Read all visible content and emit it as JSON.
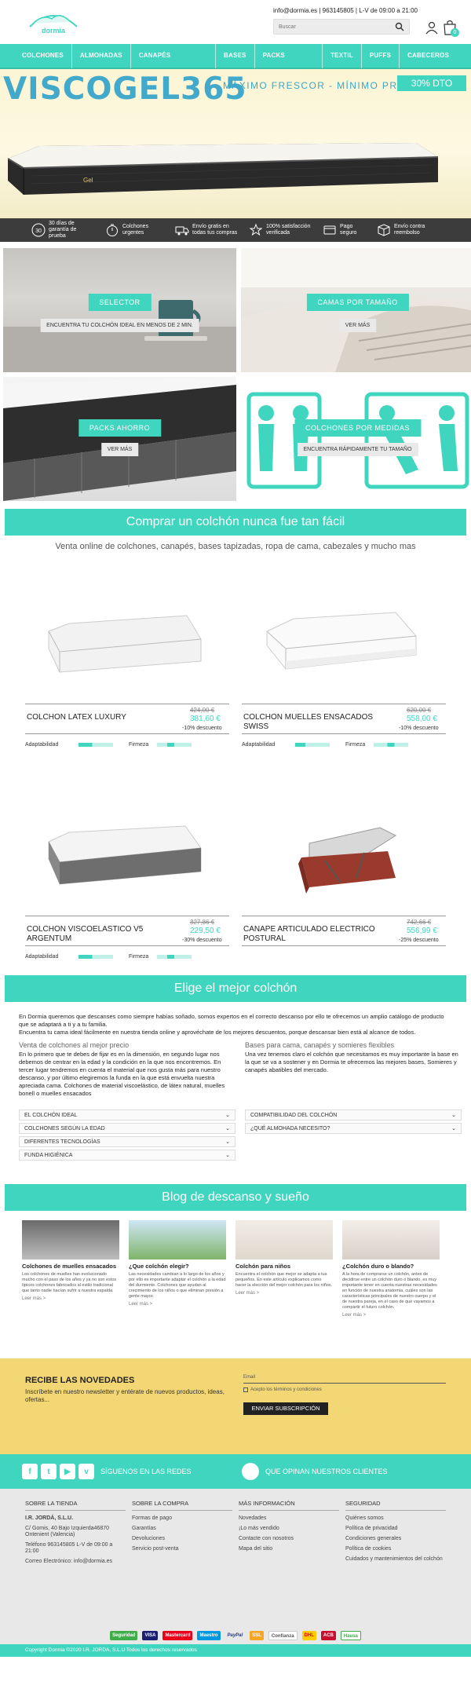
{
  "header": {
    "logo_text": "dormia",
    "contact": "info@dormia.es | 963145805 | L-V de 09:00 a 21:00",
    "search_placeholder": "Buscar",
    "cart_count": "0"
  },
  "nav": [
    "COLCHONES",
    "ALMOHADAS",
    "CANAPÉS ABATIBLES",
    "BASES",
    "PACKS AHORRO",
    "TEXTIL",
    "PUFFS",
    "CABECEROS"
  ],
  "hero": {
    "title": "VISCOGEL365",
    "slogan": "MÁXIMO FRESCOR - MÍNIMO PRECIO",
    "badge": "30% DTO"
  },
  "trust": [
    {
      "icon": "30-days-icon",
      "text": "30 días de garantía de prueba"
    },
    {
      "icon": "stopwatch-icon",
      "text": "Colchones urgentes"
    },
    {
      "icon": "truck-icon",
      "text": "Envío gratis en todas tus compras"
    },
    {
      "icon": "rating-icon",
      "text": "100% satisfacción verificada"
    },
    {
      "icon": "payment-icon",
      "text": "Pago seguro"
    },
    {
      "icon": "box-icon",
      "text": "Envío contra reembolso"
    }
  ],
  "categories": [
    {
      "label": "SELECTOR",
      "sub": "ENCUENTRA TU COLCHÓN IDEAL EN MENOS DE 2 MIN."
    },
    {
      "label": "CAMAS POR TAMAÑO",
      "sub": "VER MÁS"
    },
    {
      "label": "PACKS AHORRO",
      "sub": "VER MÁS"
    },
    {
      "label": "COLCHONES POR MEDIDAS",
      "sub": "ENCUENTRA RÁPIDAMENTE TU TAMAÑO"
    }
  ],
  "section1": {
    "title": "Comprar un colchón nunca fue tan fácil",
    "subtitle": "Venta online de colchones, canapés, bases tapizadas, ropa de cama, cabezales y mucho mas"
  },
  "products": [
    {
      "name": "COLCHON LATEX LUXURY",
      "old_price": "424,00 €",
      "price": "381,60 €",
      "discount": "-10% descuento",
      "rating1": "Adaptabilidad",
      "rating2": "Firmeza",
      "adapt_level": 0.4,
      "firm_level": 0.5
    },
    {
      "name": "COLCHON MUELLES ENSACADOS SWISS",
      "old_price": "620,00 €",
      "price": "558,00 €",
      "discount": "-10% descuento",
      "rating1": "Adaptabilidad",
      "rating2": "Firmeza",
      "adapt_level": 0.3,
      "firm_level": 0.6
    },
    {
      "name": "COLCHON VISCOELASTICO V5 ARGENTUM",
      "old_price": "327,86 €",
      "price": "229,50 €",
      "discount": "-30% descuento",
      "rating1": "Adaptabilidad",
      "rating2": "Firmeza",
      "adapt_level": 0.4,
      "firm_level": 0.5
    },
    {
      "name": "CANAPE ARTICULADO ELECTRICO POSTURAL",
      "old_price": "742,66 €",
      "price": "556,99 €",
      "discount": "-25% descuento",
      "rating1": "",
      "rating2": "",
      "adapt_level": 0,
      "firm_level": 0
    }
  ],
  "section2": {
    "title": "Elige el mejor colchón",
    "intro": "En Dormia queremos que descanses como siempre habías soñado, somos expertos en el correcto descanso por ello te ofrecemos un amplio catálogo de producto que se adaptará a ti y a tu familia.",
    "intro2": "Encuentra tu cama ideal fácilmente en nuestra tienda online y aprovéchate de los mejores descuentos, porque descansar bien está al alcance de todos.",
    "left_h": "Venta de colchones al mejor precio",
    "left_t": "En lo primero que te debes de fijar es en la dimensión, en segundo lugar nos debemos de centrar en la edad y la condición en la que nos encontremos. En tercer lugar tendremos en cuenta el material que nos gusta más para nuestro descanso, y por último elegiremos la funda en la que está envuelta nuestra apreciada cama. Colchones de material viscoelástico, de látex natural, muelles bonell o muelles ensacados",
    "right_h": "Bases para cama, canapés y somieres flexibles",
    "right_t": "Una vez tenemos claro el colchón que necesitamos es muy importante la base en la que se va a sostener y en Dormia te ofrecemos las mejores bases, Somieres y canapés abatibles del mercado.",
    "acc_left": [
      "EL COLCHÓN IDEAL",
      "COLCHONES SEGÚN LA EDAD",
      "DIFERENTES TECNOLOGÍAS",
      "FUNDA HIGIÉNICA"
    ],
    "acc_right": [
      "COMPATIBILIDAD DEL COLCHÓN",
      "¿QUÉ ALMOHADA NECESITO?"
    ]
  },
  "section3": {
    "title": "Blog de descanso y sueño"
  },
  "blog": [
    {
      "title": "Colchones de muelles ensacados",
      "text": "Los colchones de muelles han evolucionado mucho con el paso de los años y ya no son estos típicos colchones fabricados al estilo tradicional que tanto nadie hacían sufrir a nuestra espalda.",
      "more": "Leer más >"
    },
    {
      "title": "¿Que colchón elegir?",
      "text": "Las necesidades cambian a lo largo de los años y por ello es importante adaptar el colchón a la edad del durmiente. Colchones que ayudan al crecimiento de los niños o que eliminan presión a gente mayor.",
      "more": "Leer más >"
    },
    {
      "title": "Colchón para niños",
      "text": "Encuentra el colchón que mejor se adapta a tus pequeños. En este artículo explicamos como hacer la elección del mejor colchón para los niños.",
      "more": "Leer más >"
    },
    {
      "title": "¿Colchón duro o blando?",
      "text": "A la hora de comprarse un colchón, antes de decidirse entre un colchón duro o blando, es muy importante tener en cuenta nuestras necesidades en función de nuestra anatomía, cuáles son las características principales de nuestro cuerpo y el de nuestra pareja, en el caso de que vayamos a compartir el futuro colchón.",
      "more": "Leer más >"
    }
  ],
  "newsletter": {
    "title": "RECIBE LAS NOVEDADES",
    "text": "Inscríbete en nuestro newsletter y entérate de nuevos productos, ideas, ofertas...",
    "email_label": "Email",
    "accept": "Acepto los términos y condiciones",
    "button": "ENVIAR SUBSCRIPCIÓN"
  },
  "social": {
    "follow": "SÍGUENOS EN LAS REDES",
    "reviews": "QUE OPINAN NUESTROS CLIENTES"
  },
  "footer": {
    "col1_h": "SOBRE LA TIENDA",
    "col1": [
      "I.R. JORDÁ, S.L.U.",
      "C/ Gomis, 40 Bajo Izquierda46870 Ontenient (Valencia)",
      "Teléfono 963145805 L-V de 09:00 a 21:00",
      "Correo Electrónico: info@dormia.es"
    ],
    "col2_h": "SOBRE LA COMPRA",
    "col2": [
      "Formas de pago",
      "Garantías",
      "Devoluciones",
      "Servicio post-venta"
    ],
    "col3_h": "MÁS INFORMACIÓN",
    "col3": [
      "Novedades",
      "¡Lo más vendido",
      "Contacte con nosotros",
      "Mapa del sitio"
    ],
    "col4_h": "SEGURIDAD",
    "col4": [
      "Quiénes somos",
      "Política de privacidad",
      "Condiciones generales",
      "Política de cookies",
      "Cuidados y mantenimientos del colchón"
    ]
  },
  "payments": [
    "Seguridad",
    "VISA",
    "Mastercard",
    "Maestro",
    "PayPal",
    "SSL",
    "Confianza",
    "DHL",
    "ACB",
    "Hausa"
  ],
  "copyright": "Copyright Dormia ©2020 I.R. JORDA, S.L.U Todos los derechos reservados",
  "colors": {
    "accent": "#3fd5bf",
    "dark": "#3c3c3c",
    "newsletter": "#f3d775"
  }
}
